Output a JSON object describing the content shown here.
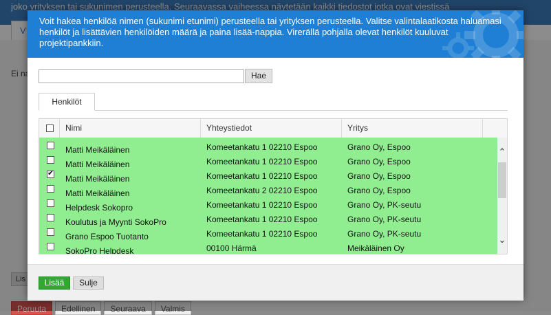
{
  "background": {
    "top_text": "joko yrityksen tai sukunimen perusteella. Seuraavassa vaiheessa näytetään kaikki tiedostot jotka ovat viestissä",
    "tab_label": "V",
    "body_text": "Ei na",
    "lis_button": "Lis",
    "nav": {
      "cancel": "Peruuta",
      "previous": "Edellinen",
      "next": "Seuraava",
      "done": "Valmis"
    }
  },
  "dialog": {
    "header_text": "Voit hakea henkilöä nimen (sukunimi etunimi) perusteella tai yrityksen perusteella. Valitse valintalaatikosta haluamasi henkilöt ja lisättävien henkilöiden määrä ja paina lisää-nappia. Virerällä pohjalla olevat henkilöt kuuluvat projektipankkiin.",
    "search": {
      "value": "",
      "placeholder": "",
      "button_label": "Hae"
    },
    "tab_label": "Henkilöt",
    "table": {
      "headers": [
        "Nimi",
        "Yhteystiedot",
        "Yritys"
      ],
      "rows": [
        {
          "checked": false,
          "name": "Matti Meikäläinen",
          "contact": "Komeetankatu 1 02210 Espoo",
          "company": "Grano Oy, Espoo"
        },
        {
          "checked": false,
          "name": "Matti Meikäläinen",
          "contact": "Komeetankatu 1 02210 Espoo",
          "company": "Grano Oy, Espoo"
        },
        {
          "checked": true,
          "name": "Matti Meikäläinen",
          "contact": "Komeetankatu 1 02210 Espoo",
          "company": "Grano Oy, Espoo"
        },
        {
          "checked": false,
          "name": "Matti Meikäläinen",
          "contact": "Komeetankatu 2 02210 Espoo",
          "company": "Grano Oy, Espoo"
        },
        {
          "checked": false,
          "name": "Helpdesk Sokopro",
          "contact": "Komeetankatu 1 02210 Espoo",
          "company": "Grano Oy, PK-seutu"
        },
        {
          "checked": false,
          "name": "Koulutus ja Myynti SokoPro",
          "contact": "Komeetankatu 1 02210 Espoo",
          "company": "Grano Oy, PK-seutu"
        },
        {
          "checked": false,
          "name": "Grano Espoo Tuotanto",
          "contact": "Komeetankatu 1 02210 Espoo",
          "company": "Grano Oy, PK-seutu"
        },
        {
          "checked": false,
          "name": "SokoPro Helpdesk",
          "contact": "00100 Härmä",
          "company": "Meikäläinen Oy"
        }
      ]
    },
    "buttons": {
      "add": "Lisää",
      "close": "Sulje"
    },
    "colors": {
      "header_bg": "#1f7fd4",
      "project_row_bg": "#90ee90",
      "add_button": "#32a832"
    }
  }
}
